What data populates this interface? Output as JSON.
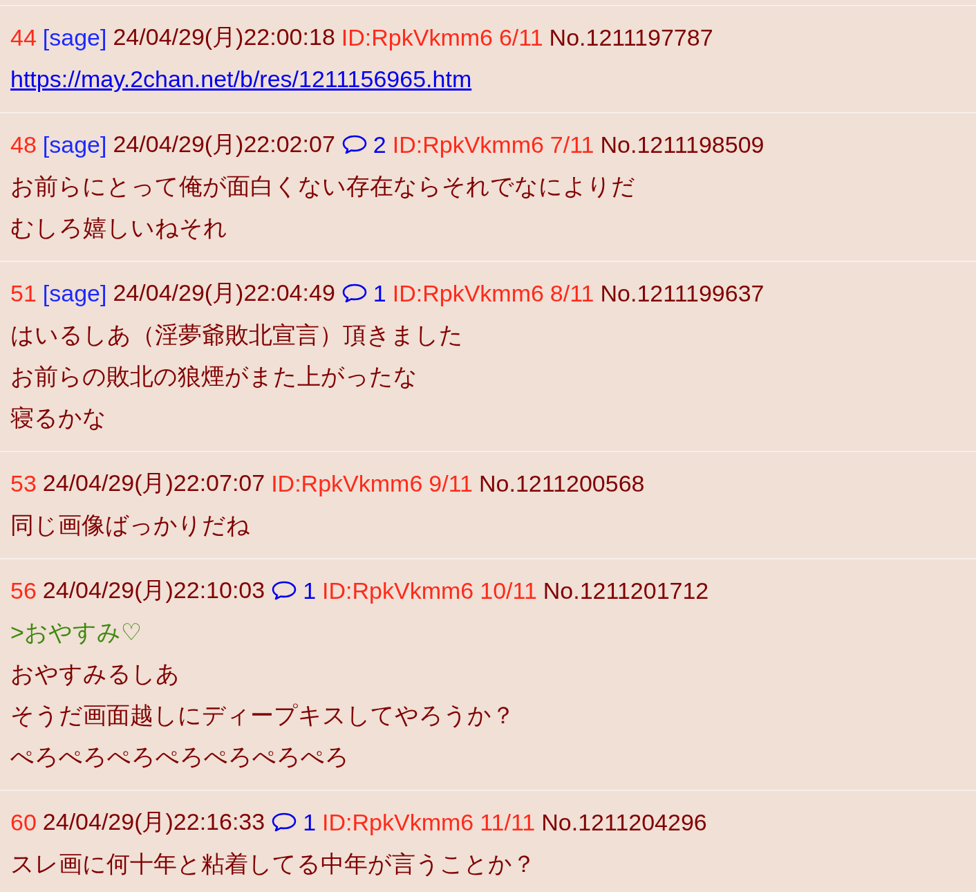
{
  "posts": [
    {
      "number": "44",
      "sage": "[sage]",
      "date": "24/04/29(月)22:00:18",
      "id": "ID:RpkVkmm6",
      "count": "6/11",
      "no": "No.1211197787",
      "lines": [
        {
          "kind": "link",
          "text": "https://may.2chan.net/b/res/1211156965.htm"
        }
      ]
    },
    {
      "number": "48",
      "sage": "[sage]",
      "date": "24/04/29(月)22:02:07",
      "replies": "2",
      "id": "ID:RpkVkmm6",
      "count": "7/11",
      "no": "No.1211198509",
      "lines": [
        {
          "kind": "text",
          "text": "お前らにとって俺が面白くない存在ならそれでなによりだ"
        },
        {
          "kind": "text",
          "text": "むしろ嬉しいねそれ"
        }
      ]
    },
    {
      "number": "51",
      "sage": "[sage]",
      "date": "24/04/29(月)22:04:49",
      "replies": "1",
      "id": "ID:RpkVkmm6",
      "count": "8/11",
      "no": "No.1211199637",
      "lines": [
        {
          "kind": "text",
          "text": "はいるしあ（淫夢爺敗北宣言）頂きました"
        },
        {
          "kind": "text",
          "text": "お前らの敗北の狼煙がまた上がったな"
        },
        {
          "kind": "text",
          "text": "寝るかな"
        }
      ]
    },
    {
      "number": "53",
      "date": "24/04/29(月)22:07:07",
      "id": "ID:RpkVkmm6",
      "count": "9/11",
      "no": "No.1211200568",
      "lines": [
        {
          "kind": "text",
          "text": "同じ画像ばっかりだね"
        }
      ]
    },
    {
      "number": "56",
      "date": "24/04/29(月)22:10:03",
      "replies": "1",
      "id": "ID:RpkVkmm6",
      "count": "10/11",
      "no": "No.1211201712",
      "lines": [
        {
          "kind": "quote",
          "text": ">おやすみ♡"
        },
        {
          "kind": "text",
          "text": "おやすみるしあ"
        },
        {
          "kind": "text",
          "text": "そうだ画面越しにディープキスしてやろうか？"
        },
        {
          "kind": "text",
          "text": "ぺろぺろぺろぺろぺろぺろぺろ"
        }
      ]
    },
    {
      "number": "60",
      "date": "24/04/29(月)22:16:33",
      "replies": "1",
      "id": "ID:RpkVkmm6",
      "count": "11/11",
      "no": "No.1211204296",
      "lines": [
        {
          "kind": "text",
          "text": "スレ画に何十年と粘着してる中年が言うことか？"
        }
      ]
    }
  ]
}
